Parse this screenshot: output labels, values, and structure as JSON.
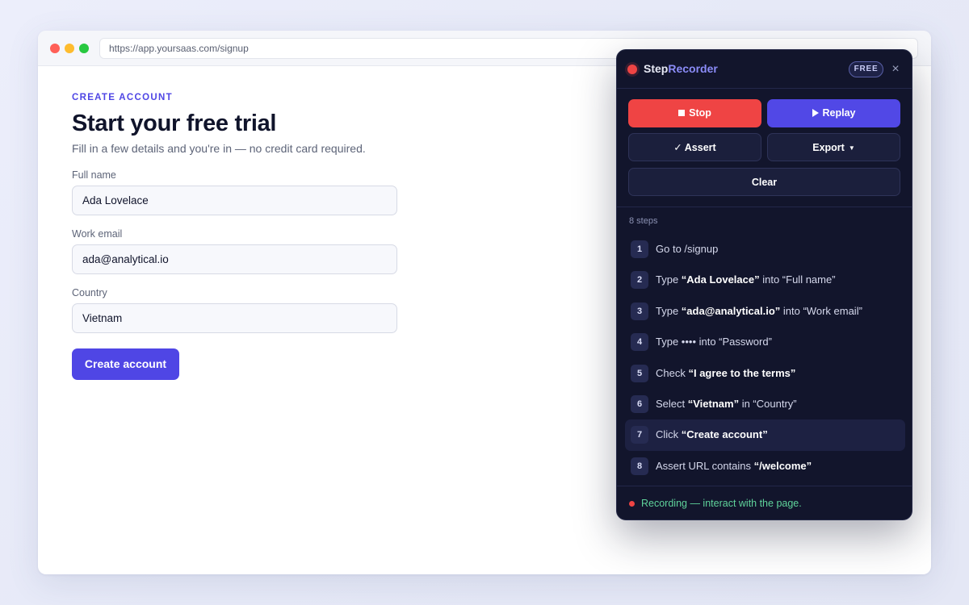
{
  "browser": {
    "url": "https://app.yoursaas.com/signup"
  },
  "signup": {
    "eyebrow": "CREATE ACCOUNT",
    "title": "Start your free trial",
    "subtitle": "Fill in a few details and you're in — no credit card required.",
    "fields": [
      {
        "label": "Full name",
        "value": "Ada Lovelace"
      },
      {
        "label": "Work email",
        "value": "ada@analytical.io"
      },
      {
        "label": "Country",
        "value": "Vietnam"
      }
    ],
    "submit_label": "Create account"
  },
  "recorder": {
    "brand_part1": "Step",
    "brand_part2": "Recorder",
    "badge": "FREE",
    "close_icon": "×",
    "buttons": {
      "stop": "Stop",
      "replay": "Replay",
      "assert": "✓ Assert",
      "export": "Export",
      "clear": "Clear"
    },
    "steps_count": "8 steps",
    "steps": [
      {
        "num": "1",
        "action": "Go to /signup",
        "target": "",
        "suffix": ""
      },
      {
        "num": "2",
        "action": "Type ",
        "target": "“Ada Lovelace”",
        "suffix": " into “Full name”"
      },
      {
        "num": "3",
        "action": "Type ",
        "target": "“ada@analytical.io”",
        "suffix": " into “Work email”"
      },
      {
        "num": "4",
        "action": "Type •••• into “Password”",
        "target": "",
        "suffix": ""
      },
      {
        "num": "5",
        "action": "Check ",
        "target": "“I agree to the terms”",
        "suffix": ""
      },
      {
        "num": "6",
        "action": "Select ",
        "target": "“Vietnam”",
        "suffix": " in “Country”"
      },
      {
        "num": "7",
        "action": "Click ",
        "target": "“Create account”",
        "suffix": ""
      },
      {
        "num": "8",
        "action": "Assert URL contains ",
        "target": "“/welcome”",
        "suffix": ""
      }
    ],
    "active_step": 7,
    "status": "Recording — interact with the page.",
    "colors": {
      "accent": "#4f46e5",
      "stop": "#ef4444",
      "status": "#5fd39b"
    }
  }
}
